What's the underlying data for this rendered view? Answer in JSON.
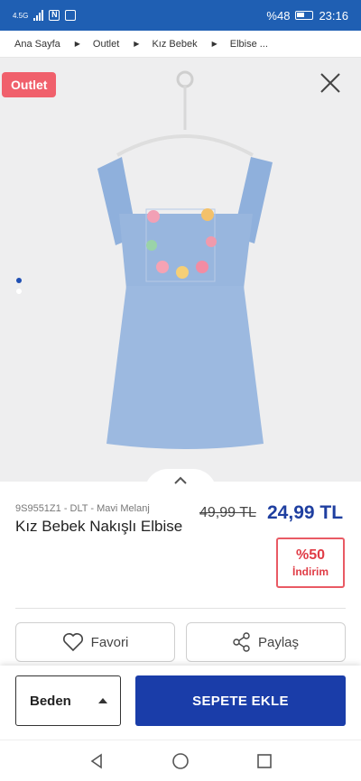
{
  "status_bar": {
    "network": "4.5G",
    "battery": "%48",
    "time": "23:16"
  },
  "breadcrumb": {
    "items": [
      "Ana Sayfa",
      "Outlet",
      "Kız Bebek",
      "Elbise ..."
    ]
  },
  "image": {
    "badge": "Outlet",
    "slide_count": 2,
    "active_slide": 1
  },
  "product": {
    "sku": "9S9551Z1 - DLT - Mavi Melanj",
    "title": "Kız Bebek Nakışlı Elbise",
    "old_price": "49,99 TL",
    "new_price": "24,99 TL",
    "discount_percent": "%50",
    "discount_label": "İndirim"
  },
  "actions": {
    "favorite": "Favori",
    "share": "Paylaş"
  },
  "bottom": {
    "size_label": "Beden",
    "add_to_cart": "SEPETE EKLE"
  },
  "colors": {
    "primary": "#1a3da9",
    "status_bar": "#1f5fb3",
    "badge": "#f0606c",
    "discount": "#e03c46",
    "dress": "#9cb9e0"
  }
}
